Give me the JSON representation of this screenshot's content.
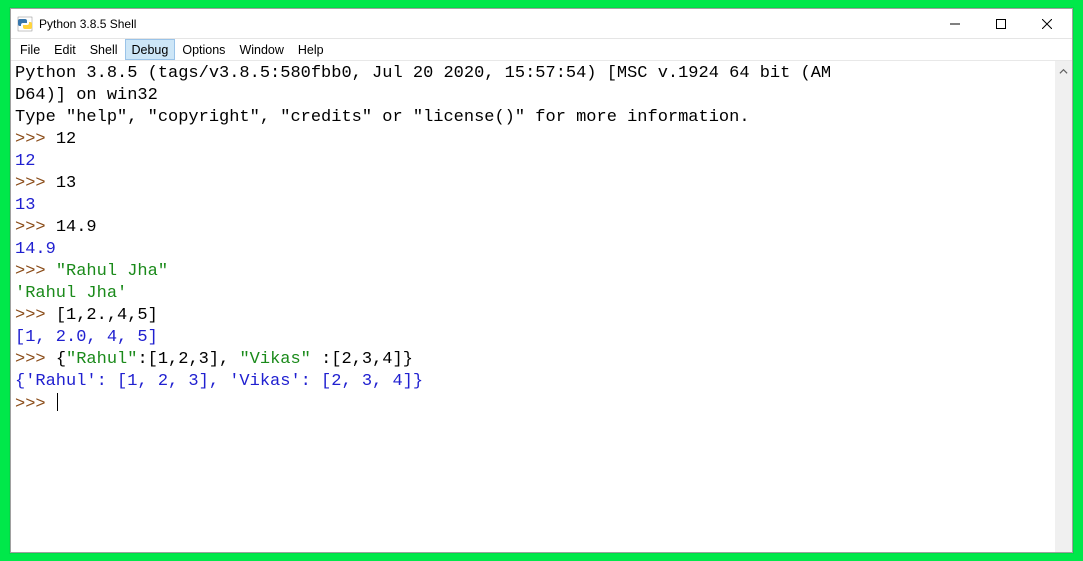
{
  "window": {
    "title": "Python 3.8.5 Shell"
  },
  "menu": {
    "items": [
      "File",
      "Edit",
      "Shell",
      "Debug",
      "Options",
      "Window",
      "Help"
    ],
    "hovered_index": 3
  },
  "shell": {
    "banner_line1": "Python 3.8.5 (tags/v3.8.5:580fbb0, Jul 20 2020, 15:57:54) [MSC v.1924 64 bit (AM",
    "banner_line2": "D64)] on win32",
    "banner_line3": "Type \"help\", \"copyright\", \"credits\" or \"license()\" for more information.",
    "prompt": ">>> ",
    "entries": [
      {
        "in_plain": "12",
        "out": "12",
        "out_class": "num-out"
      },
      {
        "in_plain": "13",
        "out": "13",
        "out_class": "num-out"
      },
      {
        "in_plain": "14.9",
        "out": "14.9",
        "out_class": "num-out"
      },
      {
        "in_str": "\"Rahul Jha\"",
        "out": "'Rahul Jha'",
        "out_class": "str-out"
      },
      {
        "in_plain": "[1,2.,4,5]",
        "out": "[1, 2.0, 4, 5]",
        "out_class": "list-out"
      },
      {
        "in_mixed_pre": "{",
        "in_str1": "\"Rahul\"",
        "in_mid1": ":[1,2,3], ",
        "in_str2": "\"Vikas\"",
        "in_mid2": " :[2,3,4]}",
        "out": "{'Rahul': [1, 2, 3], 'Vikas': [2, 3, 4]}",
        "out_class": "dict-out"
      }
    ]
  }
}
